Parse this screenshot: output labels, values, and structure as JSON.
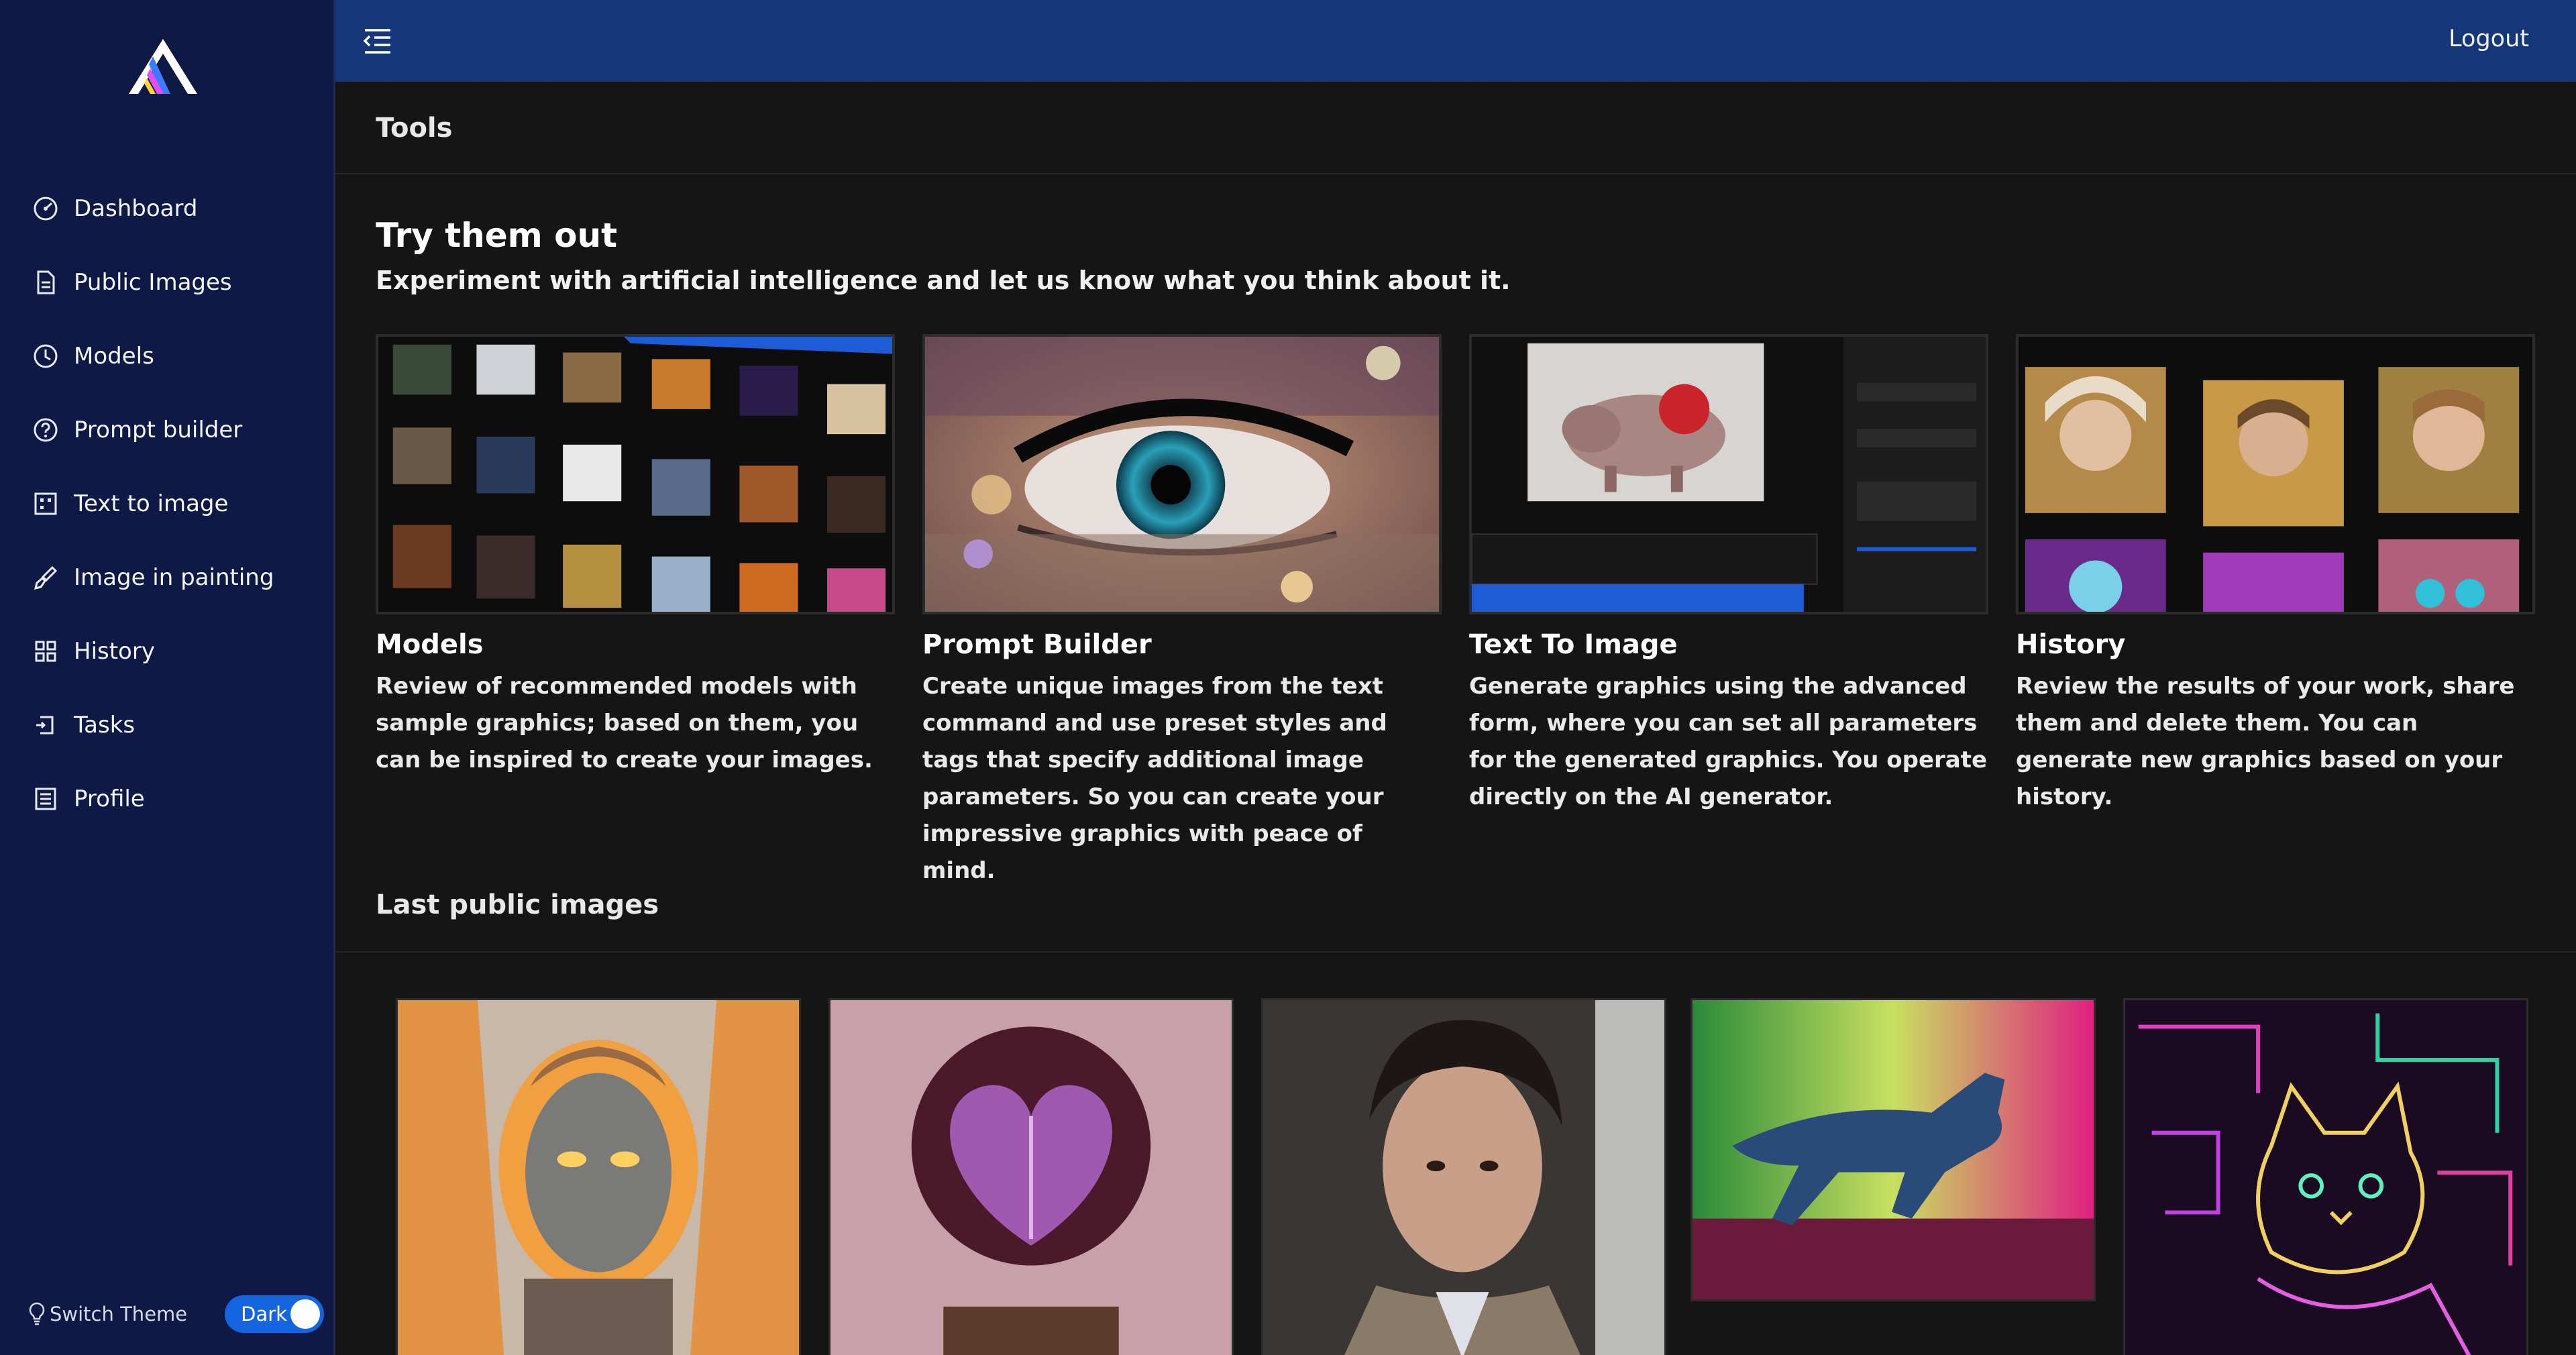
{
  "app": {
    "logout_label": "Logout"
  },
  "sidebar": {
    "items": [
      {
        "label": "Dashboard",
        "icon": "gauge-icon"
      },
      {
        "label": "Public Images",
        "icon": "document-icon"
      },
      {
        "label": "Models",
        "icon": "clock-icon"
      },
      {
        "label": "Prompt builder",
        "icon": "help-circle-icon"
      },
      {
        "label": "Text to image",
        "icon": "grid-box-icon"
      },
      {
        "label": "Image in painting",
        "icon": "brush-icon"
      },
      {
        "label": "History",
        "icon": "apps-grid-icon"
      },
      {
        "label": "Tasks",
        "icon": "tasks-icon"
      },
      {
        "label": "Profile",
        "icon": "list-box-icon"
      }
    ],
    "theme": {
      "label": "Switch Theme",
      "value": "Dark",
      "enabled": true
    }
  },
  "tools": {
    "section_title": "Tools",
    "heading": "Try them out",
    "subheading": "Experiment with artificial intelligence and let us know what you think about it.",
    "cards": [
      {
        "title": "Models",
        "description": "Review of recommended models with sample graphics; based on them, you can be inspired to create your images."
      },
      {
        "title": "Prompt Builder",
        "description": "Create unique images from the text command and use preset styles and tags that specify additional image parameters. So you can create your impressive graphics with peace of mind."
      },
      {
        "title": "Text To Image",
        "description": "Generate graphics using the advanced form, where you can set all parameters for the generated graphics. You operate directly on the AI generator."
      },
      {
        "title": "History",
        "description": "Review the results of your work, share them and delete them. You can generate new graphics based on your history."
      }
    ]
  },
  "public_images": {
    "section_title": "Last public images",
    "items": [
      {
        "subject": "fiery-statue-portrait"
      },
      {
        "subject": "purple-cabbage-heart"
      },
      {
        "subject": "curly-haired-man-portrait"
      },
      {
        "subject": "neon-wolf"
      },
      {
        "subject": "neon-line-cat"
      }
    ]
  },
  "colors": {
    "sidebar_bg": "#0e1a45",
    "topbar_bg": "#15377a",
    "page_bg": "#151515",
    "accent": "#1565e0"
  }
}
